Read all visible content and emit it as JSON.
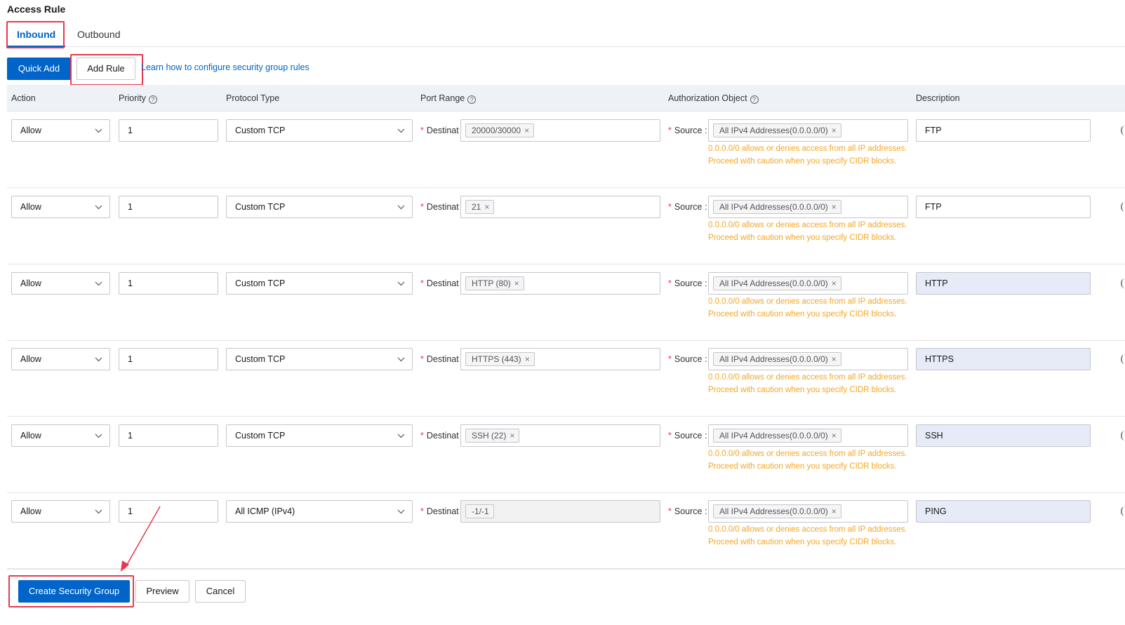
{
  "section_title": "Access Rule",
  "tabs": [
    {
      "label": "Inbound",
      "active": true
    },
    {
      "label": "Outbound",
      "active": false
    }
  ],
  "toolbar": {
    "quick_add_label": "Quick Add",
    "add_rule_label": "Add Rule",
    "help_link": "Learn how to configure security group rules"
  },
  "table": {
    "headers": {
      "action": "Action",
      "priority": "Priority",
      "protocol": "Protocol Type",
      "port_range": "Port Range",
      "auth_object": "Authorization Object",
      "description": "Description"
    },
    "help_icon": "?",
    "dest_label": "Destinat",
    "source_label": "Source :",
    "warning_text": "0.0.0.0/0 allows or denies access from all IP addresses. Proceed with caution when you specify CIDR blocks.",
    "rows": [
      {
        "action": "Allow",
        "priority": "1",
        "protocol": "Custom TCP",
        "port": "20000/30000",
        "source": "All IPv4 Addresses(0.0.0.0/0)",
        "description": "FTP"
      },
      {
        "action": "Allow",
        "priority": "1",
        "protocol": "Custom TCP",
        "port": "21",
        "source": "All IPv4 Addresses(0.0.0.0/0)",
        "description": "FTP"
      },
      {
        "action": "Allow",
        "priority": "1",
        "protocol": "Custom TCP",
        "port": "HTTP (80)",
        "source": "All IPv4 Addresses(0.0.0.0/0)",
        "description": "HTTP"
      },
      {
        "action": "Allow",
        "priority": "1",
        "protocol": "Custom TCP",
        "port": "HTTPS (443)",
        "source": "All IPv4 Addresses(0.0.0.0/0)",
        "description": "HTTPS"
      },
      {
        "action": "Allow",
        "priority": "1",
        "protocol": "Custom TCP",
        "port": "SSH (22)",
        "source": "All IPv4 Addresses(0.0.0.0/0)",
        "description": "SSH"
      },
      {
        "action": "Allow",
        "priority": "1",
        "protocol": "All ICMP (IPv4)",
        "port": "-1/-1",
        "source": "All IPv4 Addresses(0.0.0.0/0)",
        "description": "PING"
      }
    ]
  },
  "footer": {
    "create_label": "Create Security Group",
    "preview_label": "Preview",
    "cancel_label": "Cancel"
  },
  "colors": {
    "primary": "#0064c8",
    "highlight": "#e8384f",
    "warning": "#f5a623"
  }
}
